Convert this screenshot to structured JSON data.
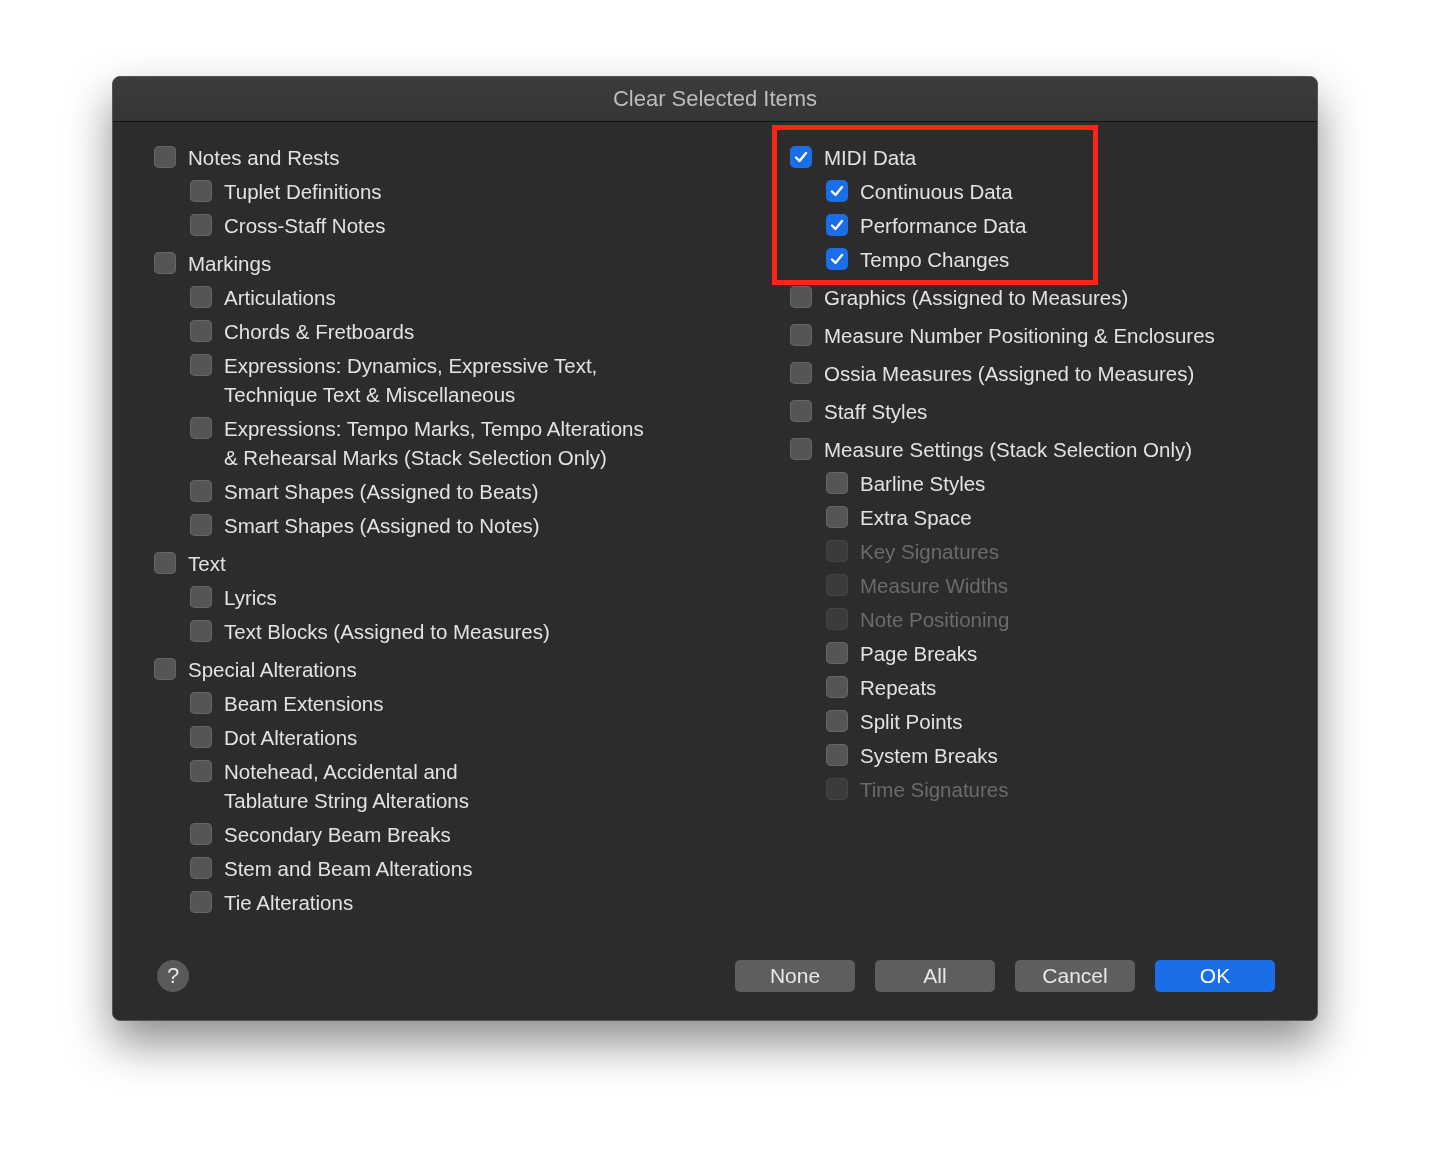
{
  "window": {
    "title": "Clear Selected Items"
  },
  "columns": [
    {
      "groups": [
        {
          "label": [
            "Notes and Rests"
          ],
          "checked": false,
          "disabled": false,
          "children": [
            {
              "label": [
                "Tuplet Definitions"
              ],
              "checked": false,
              "disabled": false
            },
            {
              "label": [
                "Cross-Staff Notes"
              ],
              "checked": false,
              "disabled": false
            }
          ]
        },
        {
          "label": [
            "Markings"
          ],
          "checked": false,
          "disabled": false,
          "children": [
            {
              "label": [
                "Articulations"
              ],
              "checked": false,
              "disabled": false
            },
            {
              "label": [
                "Chords & Fretboards"
              ],
              "checked": false,
              "disabled": false
            },
            {
              "label": [
                "Expressions: Dynamics, Expressive Text,",
                "Technique Text & Miscellaneous"
              ],
              "checked": false,
              "disabled": false
            },
            {
              "label": [
                "Expressions: Tempo Marks, Tempo Alterations",
                "& Rehearsal Marks (Stack Selection Only)"
              ],
              "checked": false,
              "disabled": false
            },
            {
              "label": [
                "Smart Shapes (Assigned to Beats)"
              ],
              "checked": false,
              "disabled": false
            },
            {
              "label": [
                "Smart Shapes (Assigned to Notes)"
              ],
              "checked": false,
              "disabled": false
            }
          ]
        },
        {
          "label": [
            "Text"
          ],
          "checked": false,
          "disabled": false,
          "children": [
            {
              "label": [
                "Lyrics"
              ],
              "checked": false,
              "disabled": false
            },
            {
              "label": [
                "Text Blocks (Assigned to Measures)"
              ],
              "checked": false,
              "disabled": false
            }
          ]
        },
        {
          "label": [
            "Special Alterations"
          ],
          "checked": false,
          "disabled": false,
          "children": [
            {
              "label": [
                "Beam Extensions"
              ],
              "checked": false,
              "disabled": false
            },
            {
              "label": [
                "Dot Alterations"
              ],
              "checked": false,
              "disabled": false
            },
            {
              "label": [
                "Notehead, Accidental and",
                "Tablature String Alterations"
              ],
              "checked": false,
              "disabled": false
            },
            {
              "label": [
                "Secondary Beam Breaks"
              ],
              "checked": false,
              "disabled": false
            },
            {
              "label": [
                "Stem and Beam Alterations"
              ],
              "checked": false,
              "disabled": false
            },
            {
              "label": [
                "Tie Alterations"
              ],
              "checked": false,
              "disabled": false
            }
          ]
        }
      ]
    },
    {
      "groups": [
        {
          "label": [
            "MIDI Data"
          ],
          "checked": true,
          "disabled": false,
          "highlighted": true,
          "children": [
            {
              "label": [
                "Continuous Data"
              ],
              "checked": true,
              "disabled": false
            },
            {
              "label": [
                "Performance Data"
              ],
              "checked": true,
              "disabled": false
            },
            {
              "label": [
                "Tempo Changes"
              ],
              "checked": true,
              "disabled": false
            }
          ]
        },
        {
          "label": [
            "Graphics (Assigned to Measures)"
          ],
          "checked": false,
          "disabled": false
        },
        {
          "label": [
            "Measure Number Positioning & Enclosures"
          ],
          "checked": false,
          "disabled": false
        },
        {
          "label": [
            "Ossia Measures (Assigned to Measures)"
          ],
          "checked": false,
          "disabled": false
        },
        {
          "label": [
            "Staff Styles"
          ],
          "checked": false,
          "disabled": false
        },
        {
          "label": [
            "Measure Settings (Stack Selection Only)"
          ],
          "checked": false,
          "disabled": false,
          "children": [
            {
              "label": [
                "Barline Styles"
              ],
              "checked": false,
              "disabled": false
            },
            {
              "label": [
                "Extra Space"
              ],
              "checked": false,
              "disabled": false
            },
            {
              "label": [
                "Key Signatures"
              ],
              "checked": false,
              "disabled": true
            },
            {
              "label": [
                "Measure Widths"
              ],
              "checked": false,
              "disabled": true
            },
            {
              "label": [
                "Note Positioning"
              ],
              "checked": false,
              "disabled": true
            },
            {
              "label": [
                "Page Breaks"
              ],
              "checked": false,
              "disabled": false
            },
            {
              "label": [
                "Repeats"
              ],
              "checked": false,
              "disabled": false
            },
            {
              "label": [
                "Split Points"
              ],
              "checked": false,
              "disabled": false
            },
            {
              "label": [
                "System Breaks"
              ],
              "checked": false,
              "disabled": false
            },
            {
              "label": [
                "Time Signatures"
              ],
              "checked": false,
              "disabled": true
            }
          ]
        }
      ]
    }
  ],
  "help": {
    "label": "?"
  },
  "buttons": [
    {
      "label": "None",
      "kind": "normal"
    },
    {
      "label": "All",
      "kind": "normal"
    },
    {
      "label": "Cancel",
      "kind": "normal"
    },
    {
      "label": "OK",
      "kind": "default"
    }
  ]
}
